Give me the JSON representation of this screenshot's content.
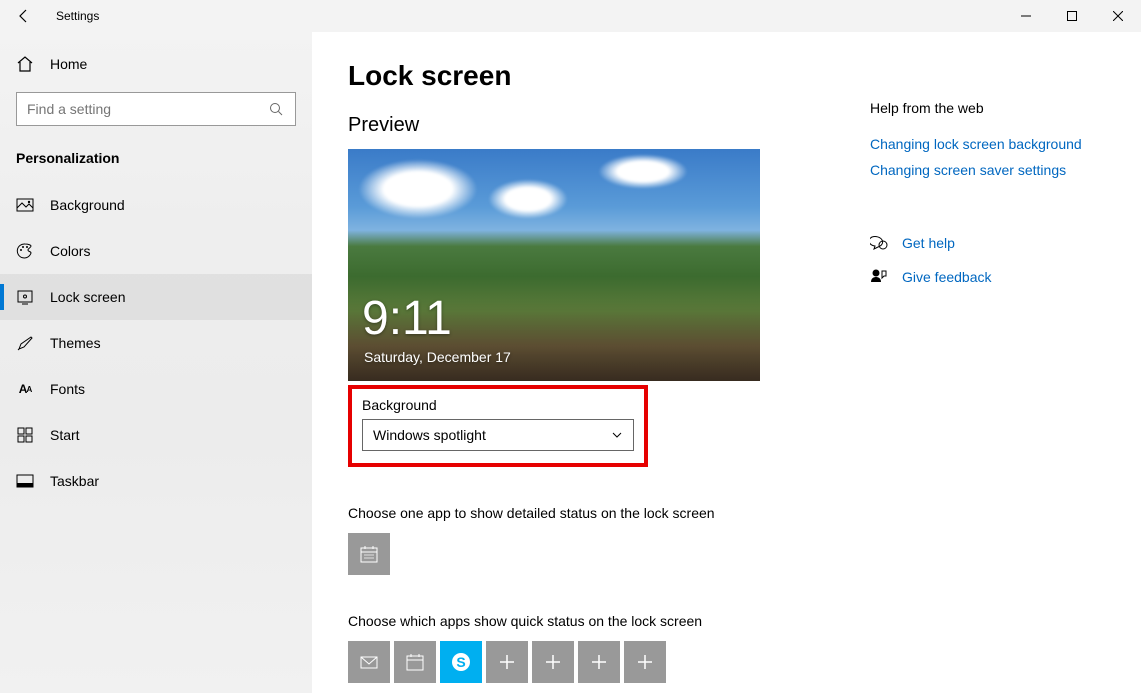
{
  "window": {
    "title": "Settings"
  },
  "sidebar": {
    "home": "Home",
    "search_placeholder": "Find a setting",
    "category": "Personalization",
    "items": [
      {
        "icon": "image",
        "label": "Background"
      },
      {
        "icon": "palette",
        "label": "Colors"
      },
      {
        "icon": "lock",
        "label": "Lock screen",
        "selected": true
      },
      {
        "icon": "brush",
        "label": "Themes"
      },
      {
        "icon": "font",
        "label": "Fonts"
      },
      {
        "icon": "start",
        "label": "Start"
      },
      {
        "icon": "taskbar",
        "label": "Taskbar"
      }
    ]
  },
  "main": {
    "title": "Lock screen",
    "preview_label": "Preview",
    "preview_time": "9:11",
    "preview_date": "Saturday, December 17",
    "background_label": "Background",
    "background_value": "Windows spotlight",
    "detailed_app_label": "Choose one app to show detailed status on the lock screen",
    "quick_apps_label": "Choose which apps show quick status on the lock screen"
  },
  "help": {
    "title": "Help from the web",
    "links": [
      "Changing lock screen background",
      "Changing screen saver settings"
    ],
    "get_help": "Get help",
    "feedback": "Give feedback"
  }
}
